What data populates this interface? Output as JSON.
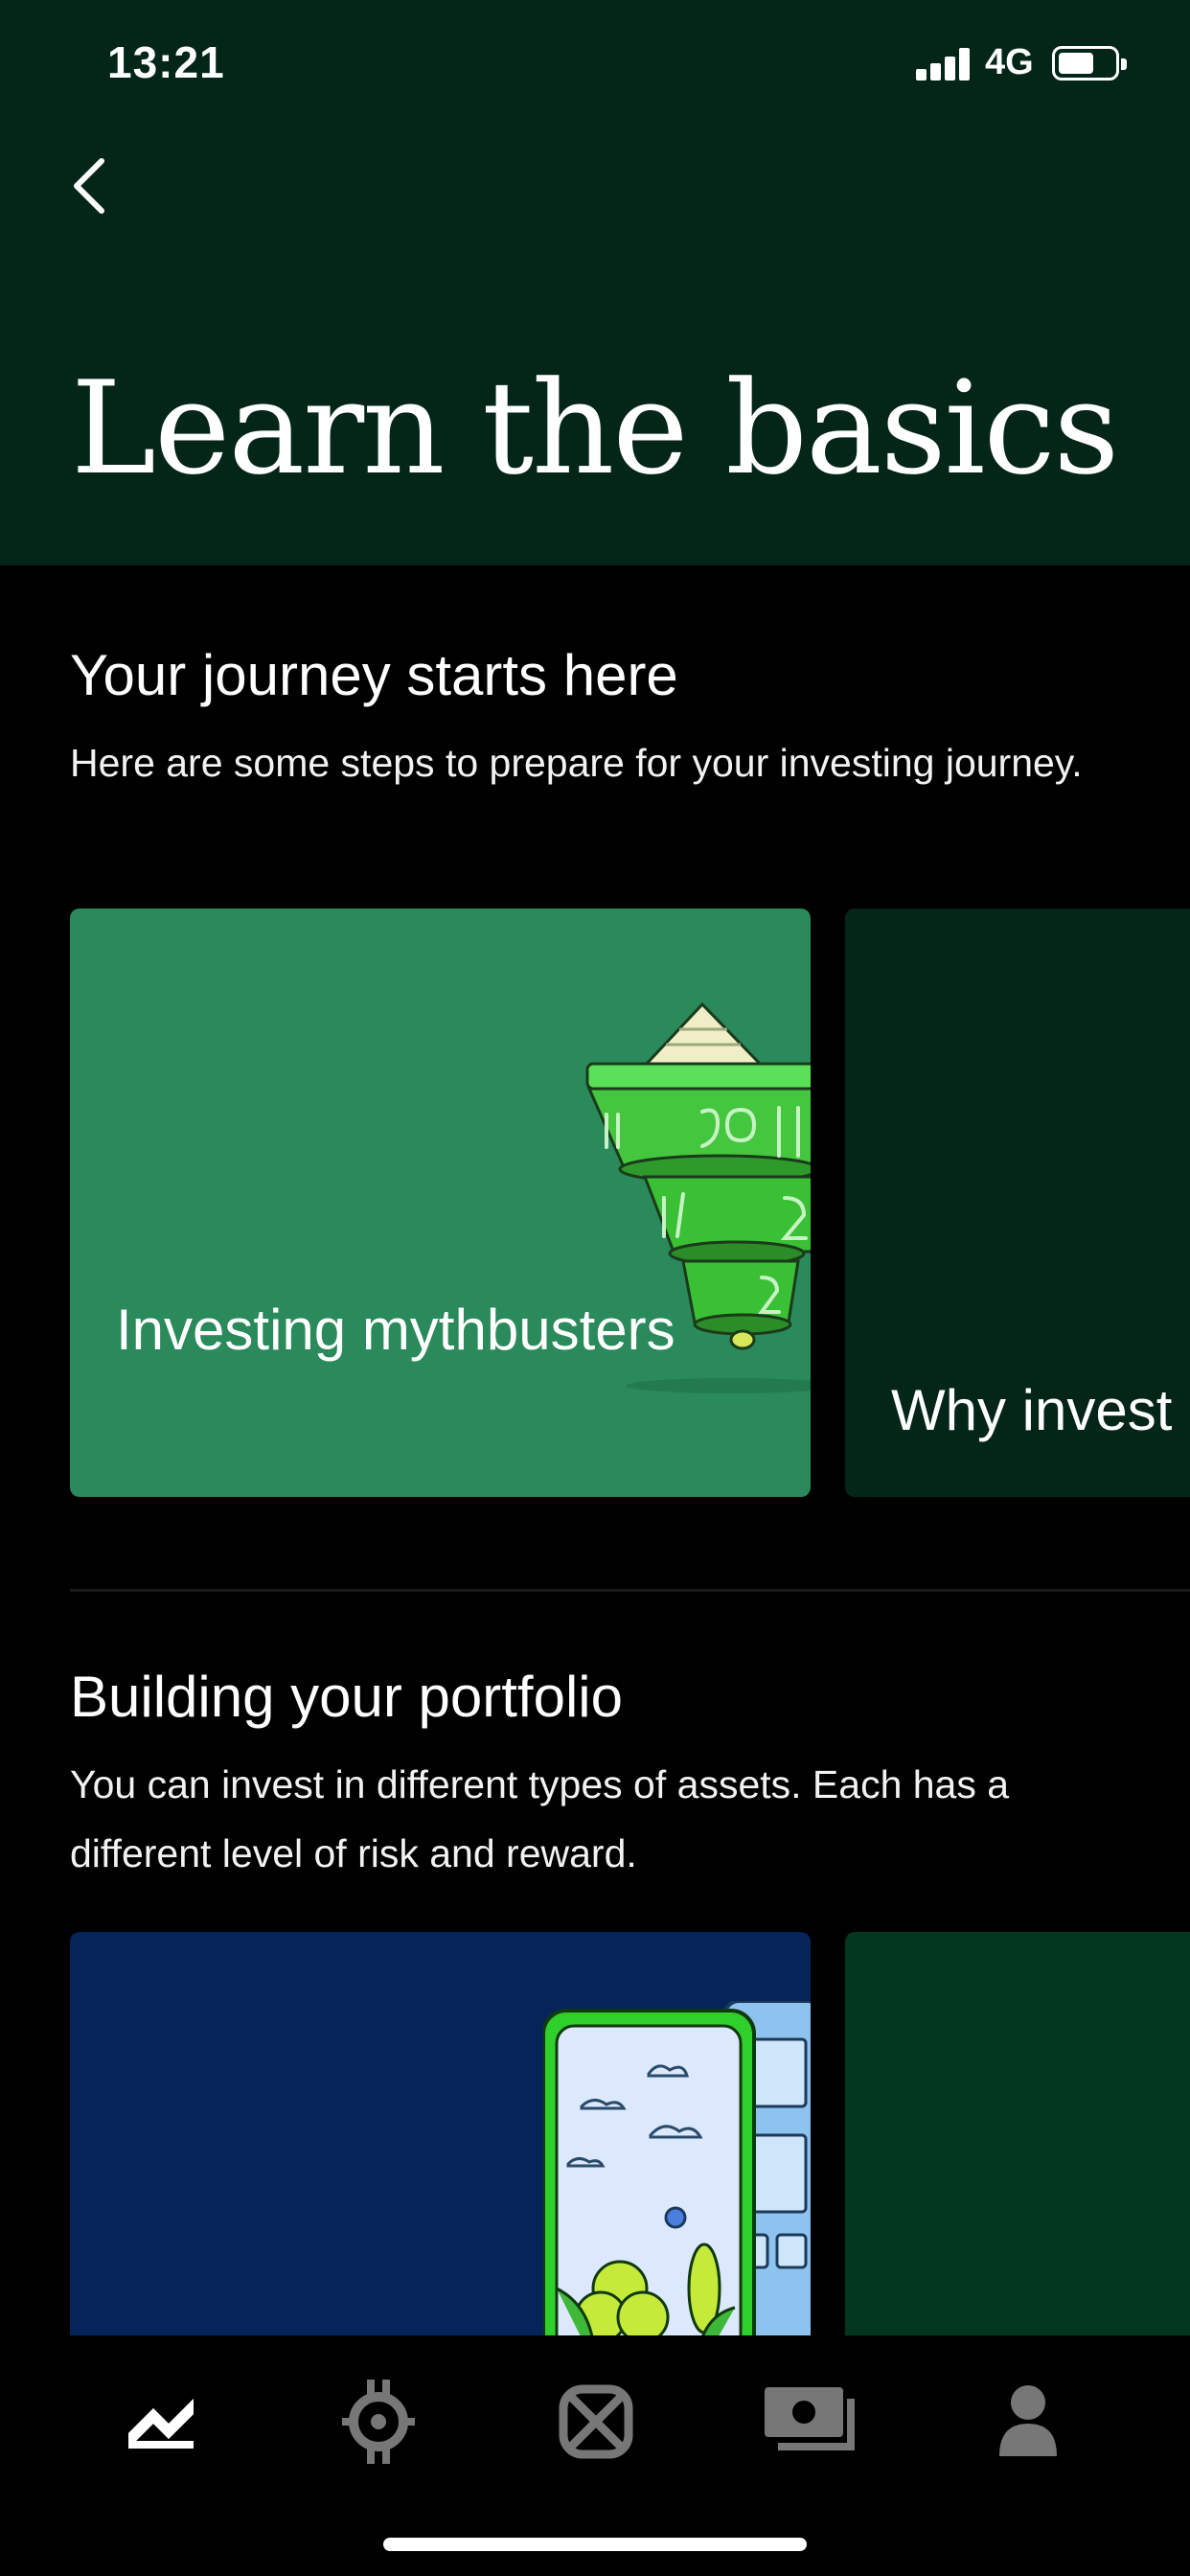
{
  "status_bar": {
    "time": "13:21",
    "network": "4G",
    "icons": [
      "signal-icon",
      "battery-icon"
    ]
  },
  "header": {
    "back_icon": "chevron-left-icon",
    "title": "Learn the basics",
    "background": "#032619"
  },
  "sections": [
    {
      "title": "Your journey starts here",
      "description": "Here are some steps to prepare for your investing journey.",
      "cards": [
        {
          "label": "Investing mythbusters",
          "background": "#2a8a5b"
        },
        {
          "label": "Why invest",
          "background": "#032619"
        }
      ]
    },
    {
      "title": "Building your portfolio",
      "description": "You can invest in different types of assets. Each has a different level of risk and reward.",
      "cards": [
        {
          "label": "",
          "background": "#04245a"
        },
        {
          "label": "",
          "background": "#03361f"
        }
      ]
    }
  ],
  "bottom_nav": {
    "items": [
      {
        "icon": "investing-chart-icon",
        "active": true
      },
      {
        "icon": "crypto-icon",
        "active": false
      },
      {
        "icon": "spending-icon",
        "active": false
      },
      {
        "icon": "retirement-icon",
        "active": false
      },
      {
        "icon": "account-icon",
        "active": false
      }
    ]
  }
}
